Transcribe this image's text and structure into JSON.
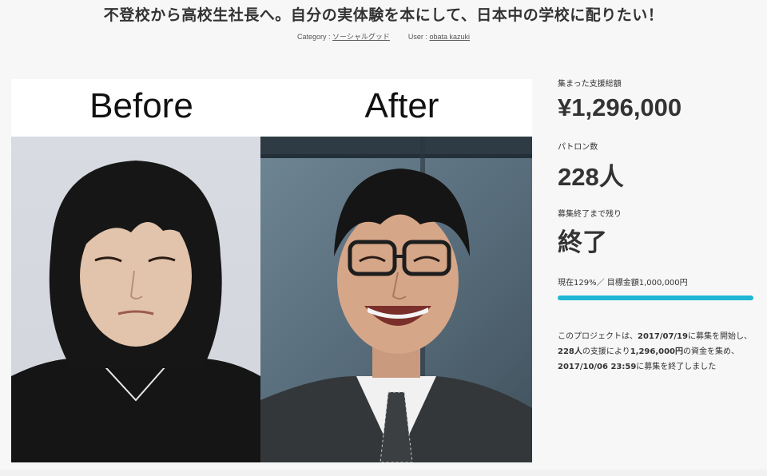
{
  "page": {
    "title": "不登校から高校生社長へ。自分の実体験を本にして、日本中の学校に配りたい！",
    "category_label": "Category :",
    "category_value": "ソーシャルグッド",
    "user_label": "User :",
    "user_value": "obata kazuki"
  },
  "hero": {
    "before_label": "Before",
    "after_label": "After"
  },
  "stats": {
    "funded_label": "集まった支援総額",
    "funded_value": "¥1,296,000",
    "patrons_label": "パトロン数",
    "patrons_value": "228人",
    "remaining_label": "募集終了まで残り",
    "remaining_value": "終了",
    "progress_text": "現在129%／ 目標金額1,000,000円",
    "progress_fraction": 1.0
  },
  "summary": {
    "line1_prefix": "このプロジェクトは、",
    "start_date": "2017/07/19",
    "line1_suffix": "に募集を開始し、",
    "patrons": "228人",
    "line2_mid": "の支援により",
    "amount": "1,296,000円",
    "line2_suffix": "の資金を集め、",
    "end_datetime": "2017/10/06 23:59",
    "line3_suffix": "に募集を終了しました"
  },
  "colors": {
    "accent": "#1fb7d4",
    "text": "#333333",
    "background": "#f7f7f7"
  }
}
